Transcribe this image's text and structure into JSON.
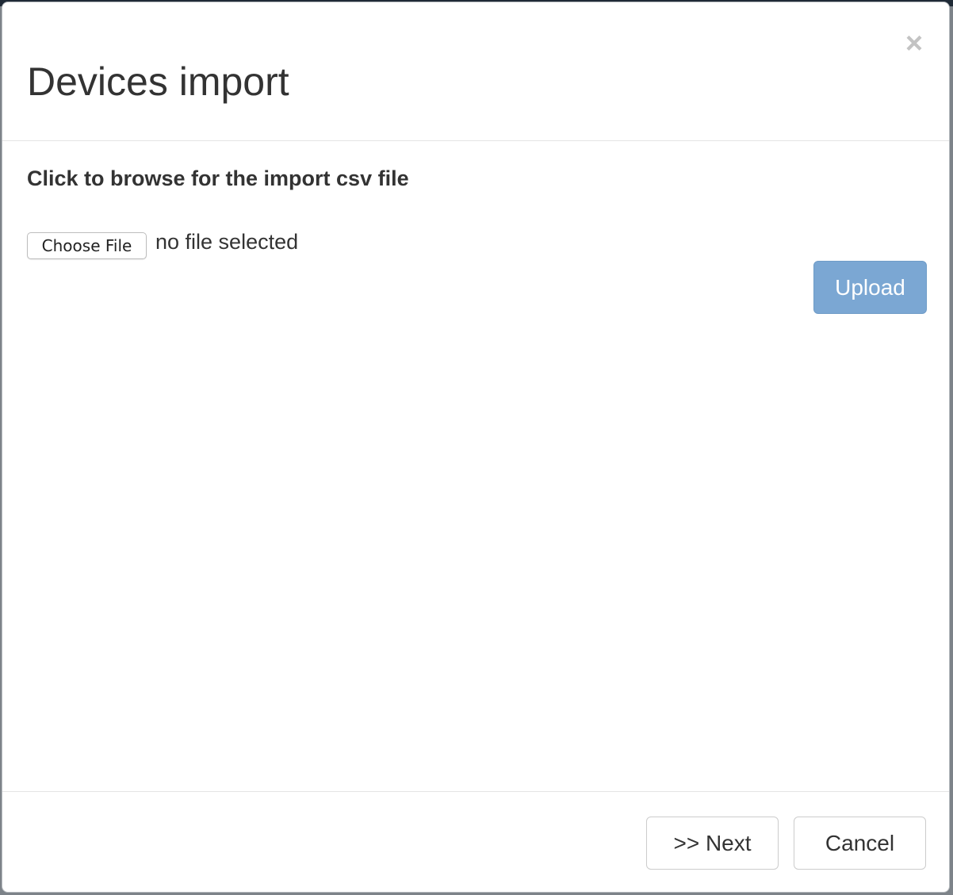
{
  "modal": {
    "title": "Devices import",
    "close_glyph": "×",
    "close_icon": "close-icon"
  },
  "body": {
    "instruction": "Click to browse for the import csv file",
    "choose_file_label": "Choose File",
    "file_status": "no file selected",
    "upload_label": "Upload"
  },
  "footer": {
    "next_label": ">> Next",
    "cancel_label": "Cancel"
  },
  "colors": {
    "upload_button": "#7ba7d3",
    "backdrop": "#1f2a36"
  }
}
